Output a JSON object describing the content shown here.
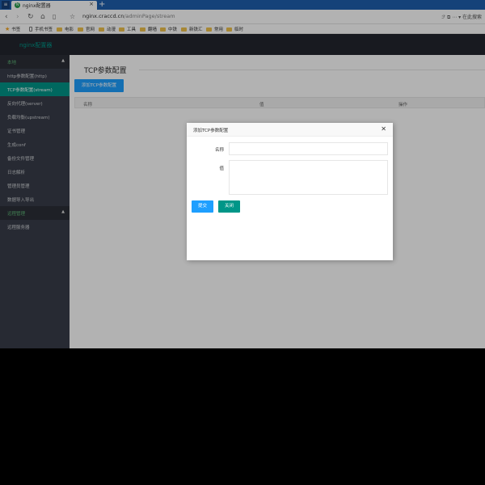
{
  "browser": {
    "tab_title": "nginx配置器",
    "tab_favicon": "N",
    "new_tab": "+",
    "url_host": "nginx.craccd.cn",
    "url_path": "/adminPage/stream",
    "right_tools": "ℱ ⧉ ⋯ ▾ 在此搜索",
    "icons": [
      "back-arrow-icon",
      "forward-arrow-icon",
      "refresh-icon",
      "home-icon",
      "reader-icon",
      "star-icon"
    ]
  },
  "bookmarks": [
    {
      "label": "书签",
      "icon": "star-icon"
    },
    {
      "label": "手机书签",
      "icon": "phone-icon"
    },
    {
      "label": "电影",
      "icon": "folder-icon"
    },
    {
      "label": "官网",
      "icon": "folder-icon"
    },
    {
      "label": "动漫",
      "icon": "folder-icon"
    },
    {
      "label": "工具",
      "icon": "folder-icon"
    },
    {
      "label": "翻墙",
      "icon": "folder-icon"
    },
    {
      "label": "中铁",
      "icon": "folder-icon"
    },
    {
      "label": "新铁汇",
      "icon": "folder-icon"
    },
    {
      "label": "常用",
      "icon": "folder-icon"
    },
    {
      "label": "临时",
      "icon": "folder-icon"
    }
  ],
  "app": {
    "logo": "nginx配置器"
  },
  "sidebar": {
    "group_local": "本地",
    "group_remote": "远程管理",
    "caret": "▲",
    "items": [
      {
        "label": "http参数配置(http)",
        "active": false
      },
      {
        "label": "TCP参数配置(stream)",
        "active": true
      },
      {
        "label": "反向代理(server)",
        "active": false
      },
      {
        "label": "负载均衡(upstream)",
        "active": false
      },
      {
        "label": "证书管理",
        "active": false
      },
      {
        "label": "生成conf",
        "active": false
      },
      {
        "label": "备份文件管理",
        "active": false
      },
      {
        "label": "日志解析",
        "active": false
      },
      {
        "label": "管理员管理",
        "active": false
      },
      {
        "label": "数据导入导出",
        "active": false
      }
    ],
    "remote_items": [
      {
        "label": "远程服务器",
        "active": false
      }
    ]
  },
  "main": {
    "title": "TCP参数配置",
    "add_button": "添加TCP参数配置",
    "columns": [
      "名称",
      "值",
      "操作"
    ]
  },
  "modal": {
    "title": "添加TCP参数配置",
    "close": "✕",
    "name_label": "名称",
    "name_value": "",
    "value_label": "值",
    "value_value": "",
    "submit": "提交",
    "cancel": "关闭"
  },
  "colors": {
    "accent": "#009688",
    "primary": "#1e9fff",
    "sidebar": "#393d49",
    "header": "#23262e"
  }
}
